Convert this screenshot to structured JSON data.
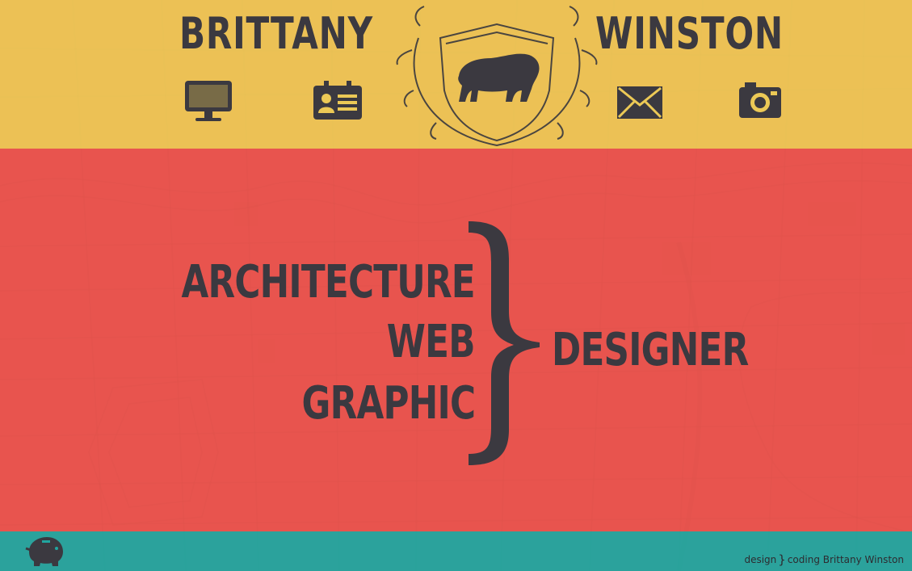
{
  "header": {
    "first_name": "BRITTANY",
    "last_name": "WINSTON",
    "nav": [
      {
        "id": "web",
        "icon": "monitor-icon"
      },
      {
        "id": "resume",
        "icon": "id-card-icon"
      },
      {
        "id": "contact",
        "icon": "envelope-icon"
      },
      {
        "id": "photography",
        "icon": "camera-icon"
      }
    ],
    "crest_icon": "bear-crest-icon"
  },
  "main": {
    "disciplines": [
      "ARCHITECTURE",
      "WEB",
      "GRAPHIC"
    ],
    "role": "DESIGNER"
  },
  "footer": {
    "credit_design": "design",
    "credit_coding": "coding Brittany Winston",
    "piggy_icon": "piggy-bank-icon"
  },
  "colors": {
    "top_band": "#ECC956",
    "middle_band": "#E8544E",
    "bottom_band": "#21A6A0",
    "ink": "#3B3940"
  }
}
